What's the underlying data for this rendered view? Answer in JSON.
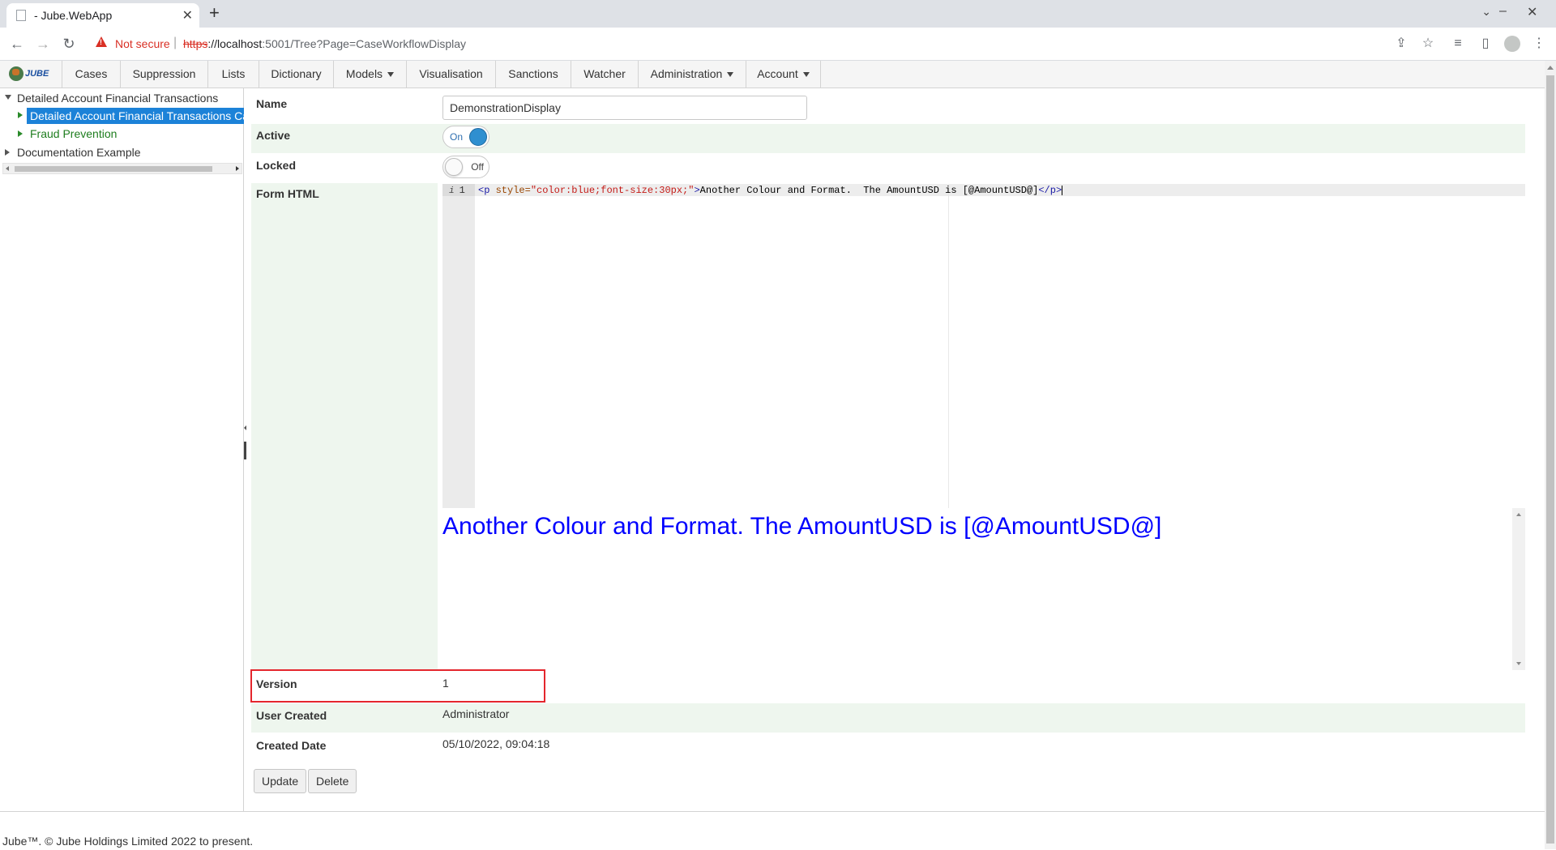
{
  "browser": {
    "tab_title": "- Jube.WebApp",
    "tab_close": "✕",
    "new_tab": "+",
    "not_secure": "Not secure",
    "url_scheme": "https",
    "url_host": "://localhost",
    "url_rest": ":5001/Tree?Page=CaseWorkflowDisplay"
  },
  "nav": {
    "logo_text": "JUBE",
    "items": [
      {
        "label": "Cases"
      },
      {
        "label": "Suppression"
      },
      {
        "label": "Lists"
      },
      {
        "label": "Dictionary"
      },
      {
        "label": "Models"
      },
      {
        "label": "Visualisation"
      },
      {
        "label": "Sanctions"
      },
      {
        "label": "Watcher"
      },
      {
        "label": "Administration"
      },
      {
        "label": "Account"
      }
    ]
  },
  "tree": {
    "root": "Detailed Account Financial Transactions",
    "selected": "Detailed Account Financial Transactions Case Workflow",
    "child2": "Fraud Prevention",
    "root2": "Documentation Example"
  },
  "form": {
    "name_label": "Name",
    "name_value": "DemonstrationDisplay",
    "active_label": "Active",
    "active_toggle_text": "On",
    "active_state": true,
    "locked_label": "Locked",
    "locked_toggle_text": "Off",
    "locked_state": false,
    "html_label": "Form HTML",
    "editor_line_number": "1",
    "editor_code": {
      "open_tag": "<p",
      "attr_name": " style=",
      "attr_value": "\"color:blue;font-size:30px;\"",
      "tag_close": ">",
      "text": "Another Colour and Format.  The AmountUSD is [@AmountUSD@]",
      "end_tag": "</p>"
    },
    "preview_text": "Another Colour and Format. The AmountUSD is [@AmountUSD@]",
    "preview_color": "#0000ff",
    "version_label": "Version",
    "version_value": "1",
    "user_created_label": "User Created",
    "user_created_value": "Administrator",
    "created_date_label": "Created Date",
    "created_date_value": "05/10/2022, 09:04:18",
    "update_button": "Update",
    "delete_button": "Delete"
  },
  "footer": {
    "text": "Jube™. © Jube Holdings Limited 2022 to present."
  },
  "colors": {
    "accent": "#1c82d8",
    "row_band": "#eef6ee",
    "highlight": "#e4262d",
    "tree_green": "#1e7d1e"
  }
}
